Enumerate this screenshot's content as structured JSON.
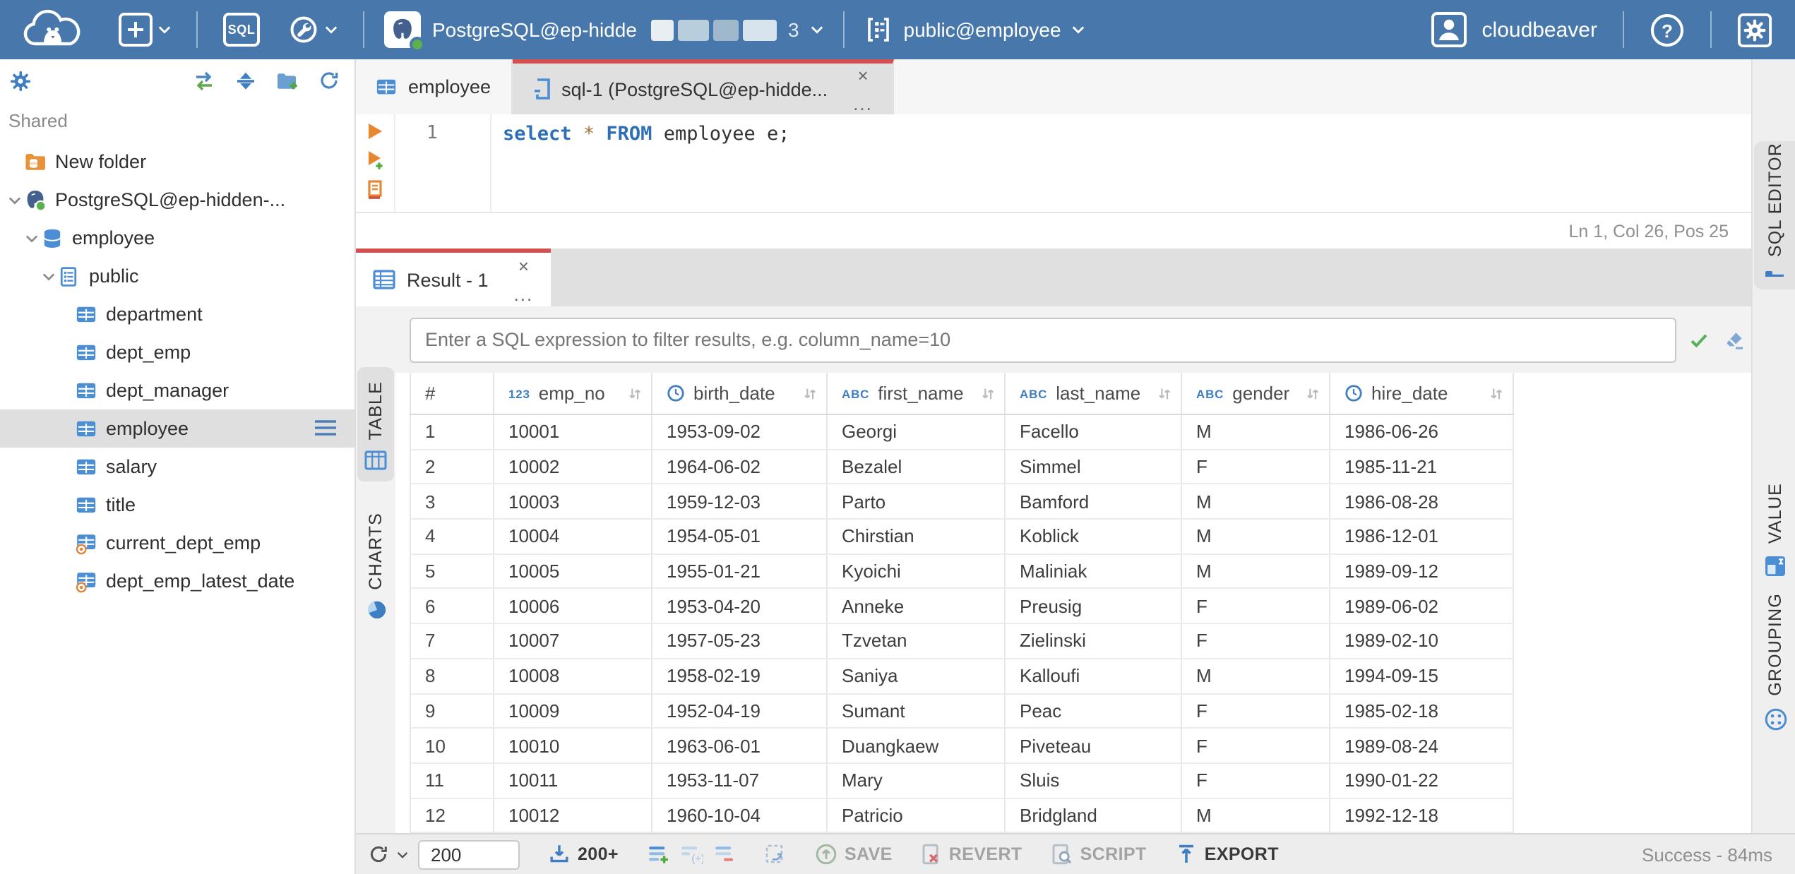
{
  "colors": {
    "topbar": "#4878ab",
    "accent_red": "#d4504e",
    "accent_blue": "#3f7ec2",
    "selection_gray": "#dfdfdf"
  },
  "topbar": {
    "logo": "cloudbeaver-logo",
    "new_connection_icon": "plus-icon",
    "sql_button_label": "SQL",
    "driver_icon": "wrench-icon",
    "connection": {
      "label": "PostgreSQL@ep-hidde",
      "masked_suffix": "3"
    },
    "schema": {
      "label": "public@employee"
    },
    "user": {
      "name": "cloudbeaver"
    }
  },
  "sidebar": {
    "shared_label": "Shared",
    "toolbar_icons": [
      "settings-gear",
      "sync-connection",
      "collapse-all",
      "new-folder",
      "refresh"
    ],
    "tree": [
      {
        "label": "New folder",
        "icon": "folder-db",
        "depth": 0,
        "chevron": false,
        "selected": false
      },
      {
        "label": "PostgreSQL@ep-hidden-...",
        "icon": "postgres",
        "depth": 0,
        "chevron": true,
        "selected": false
      },
      {
        "label": "employee",
        "icon": "database",
        "depth": 1,
        "chevron": true,
        "selected": false
      },
      {
        "label": "public",
        "icon": "schema",
        "depth": 2,
        "chevron": true,
        "selected": false
      },
      {
        "label": "department",
        "icon": "table",
        "depth": 3,
        "chevron": false,
        "selected": false
      },
      {
        "label": "dept_emp",
        "icon": "table",
        "depth": 3,
        "chevron": false,
        "selected": false
      },
      {
        "label": "dept_manager",
        "icon": "table",
        "depth": 3,
        "chevron": false,
        "selected": false
      },
      {
        "label": "employee",
        "icon": "table",
        "depth": 3,
        "chevron": false,
        "selected": true
      },
      {
        "label": "salary",
        "icon": "table",
        "depth": 3,
        "chevron": false,
        "selected": false
      },
      {
        "label": "title",
        "icon": "table",
        "depth": 3,
        "chevron": false,
        "selected": false
      },
      {
        "label": "current_dept_emp",
        "icon": "view",
        "depth": 3,
        "chevron": false,
        "selected": false
      },
      {
        "label": "dept_emp_latest_date",
        "icon": "view",
        "depth": 3,
        "chevron": false,
        "selected": false
      }
    ]
  },
  "editor": {
    "tabs": [
      {
        "label": "employee",
        "icon": "table",
        "active": false
      },
      {
        "label": "sql-1 (PostgreSQL@ep-hidde...",
        "icon": "sql-script",
        "active": true,
        "close": "×",
        "menu": "..."
      }
    ],
    "line_number": "1",
    "code_tokens": [
      {
        "text": "select",
        "type": "kw"
      },
      {
        "text": " ",
        "type": "plain"
      },
      {
        "text": "*",
        "type": "star"
      },
      {
        "text": " ",
        "type": "plain"
      },
      {
        "text": "FROM",
        "type": "kw"
      },
      {
        "text": " employee e;",
        "type": "plain"
      }
    ],
    "status": "Ln 1, Col 26, Pos 25",
    "side_tab": "SQL EDITOR"
  },
  "result": {
    "tab_label": "Result - 1",
    "tab_close": "×",
    "tab_menu": "...",
    "filter_placeholder": "Enter a SQL expression to filter results, e.g. column_name=10",
    "left_tabs": [
      {
        "label": "TABLE",
        "icon": "grid-icon",
        "selected": true
      },
      {
        "label": "CHARTS",
        "icon": "pie-icon",
        "selected": false
      }
    ],
    "right_tabs": [
      {
        "label": "VALUE",
        "icon": "value-icon"
      },
      {
        "label": "GROUPING",
        "icon": "grouping-icon"
      }
    ],
    "columns": [
      {
        "name": "#",
        "type": "rownum"
      },
      {
        "name": "emp_no",
        "type": "number",
        "badge": "123"
      },
      {
        "name": "birth_date",
        "type": "date"
      },
      {
        "name": "first_name",
        "type": "text",
        "badge": "ABC"
      },
      {
        "name": "last_name",
        "type": "text",
        "badge": "ABC"
      },
      {
        "name": "gender",
        "type": "text",
        "badge": "ABC"
      },
      {
        "name": "hire_date",
        "type": "date"
      }
    ],
    "rows": [
      [
        "1",
        "10001",
        "1953-09-02",
        "Georgi",
        "Facello",
        "M",
        "1986-06-26"
      ],
      [
        "2",
        "10002",
        "1964-06-02",
        "Bezalel",
        "Simmel",
        "F",
        "1985-11-21"
      ],
      [
        "3",
        "10003",
        "1959-12-03",
        "Parto",
        "Bamford",
        "M",
        "1986-08-28"
      ],
      [
        "4",
        "10004",
        "1954-05-01",
        "Chirstian",
        "Koblick",
        "M",
        "1986-12-01"
      ],
      [
        "5",
        "10005",
        "1955-01-21",
        "Kyoichi",
        "Maliniak",
        "M",
        "1989-09-12"
      ],
      [
        "6",
        "10006",
        "1953-04-20",
        "Anneke",
        "Preusig",
        "F",
        "1989-06-02"
      ],
      [
        "7",
        "10007",
        "1957-05-23",
        "Tzvetan",
        "Zielinski",
        "F",
        "1989-02-10"
      ],
      [
        "8",
        "10008",
        "1958-02-19",
        "Saniya",
        "Kalloufi",
        "M",
        "1994-09-15"
      ],
      [
        "9",
        "10009",
        "1952-04-19",
        "Sumant",
        "Peac",
        "F",
        "1985-02-18"
      ],
      [
        "10",
        "10010",
        "1963-06-01",
        "Duangkaew",
        "Piveteau",
        "F",
        "1989-08-24"
      ],
      [
        "11",
        "10011",
        "1953-11-07",
        "Mary",
        "Sluis",
        "F",
        "1990-01-22"
      ],
      [
        "12",
        "10012",
        "1960-10-04",
        "Patricio",
        "Bridgland",
        "M",
        "1992-12-18"
      ]
    ]
  },
  "toolbar": {
    "row_limit": "200",
    "fetch_label": "200+",
    "save_label": "SAVE",
    "revert_label": "REVERT",
    "script_label": "SCRIPT",
    "export_label": "EXPORT",
    "status": "Success - 84ms"
  }
}
